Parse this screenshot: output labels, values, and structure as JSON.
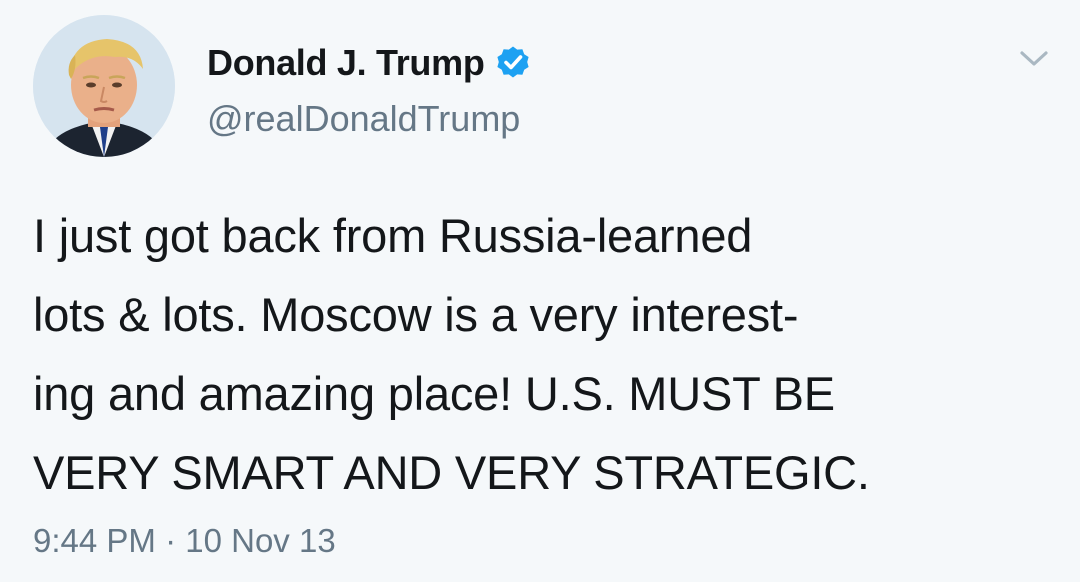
{
  "author": {
    "display_name": "Donald J. Trump",
    "handle": "@realDonaldTrump",
    "verified": true,
    "avatar_icon": "profile-photo"
  },
  "tweet": {
    "text": "I just got back from Russia-learned\nlots & lots. Moscow is a very interest-\ning and amazing place! U.S. MUST BE\nVERY SMART AND VERY STRATEGIC.",
    "time": "9:44 PM",
    "separator": "·",
    "date": "10 Nov 13"
  },
  "icons": {
    "verified": "verified-badge-icon",
    "menu": "chevron-down-icon"
  },
  "colors": {
    "background": "#f5f8fa",
    "text": "#14171a",
    "secondary_text": "#657786",
    "verified_blue": "#1da1f2"
  }
}
